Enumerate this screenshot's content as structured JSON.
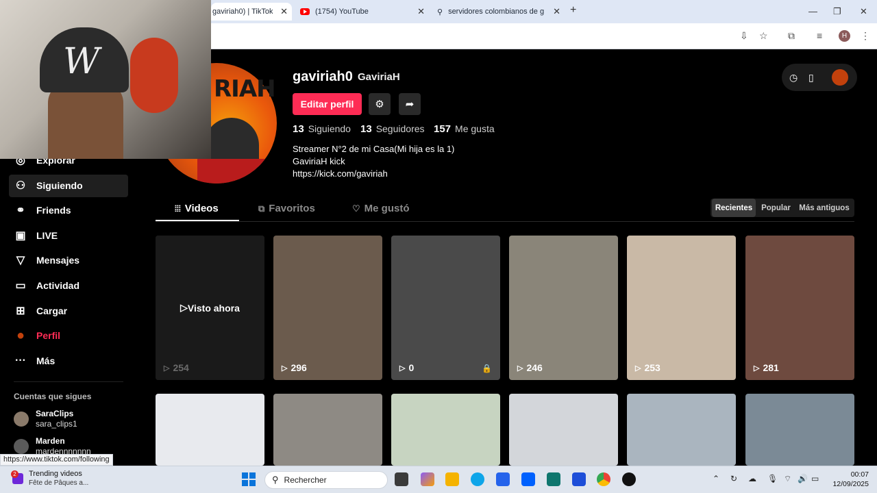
{
  "browser": {
    "tabs": [
      {
        "title": "gaviriah0) | TikTok",
        "active": true
      },
      {
        "title": "(1754) YouTube",
        "active": false
      },
      {
        "title": "servidores colombianos de gta",
        "active": false
      }
    ],
    "new_tab": "+",
    "window_controls": {
      "minimize": "—",
      "maximize": "❐",
      "close": "✕"
    },
    "profile_initial": "H"
  },
  "sidebar": {
    "items": [
      {
        "label": "Explorar",
        "icon": "compass-icon",
        "glyph": "◎"
      },
      {
        "label": "Siguiendo",
        "icon": "following-icon",
        "glyph": "⚇"
      },
      {
        "label": "Friends",
        "icon": "friends-icon",
        "glyph": "⚭"
      },
      {
        "label": "LIVE",
        "icon": "live-icon",
        "glyph": "▣"
      },
      {
        "label": "Mensajes",
        "icon": "messages-icon",
        "glyph": "▽"
      },
      {
        "label": "Actividad",
        "icon": "activity-icon",
        "glyph": "▭"
      },
      {
        "label": "Cargar",
        "icon": "upload-icon",
        "glyph": "⊞"
      },
      {
        "label": "Perfil",
        "icon": "profile-avatar-icon",
        "glyph": "●"
      },
      {
        "label": "Más",
        "icon": "more-icon",
        "glyph": "···"
      }
    ],
    "following_title": "Cuentas que sigues",
    "accounts": [
      {
        "name": "SaraClips",
        "handle": "sara_clips1"
      },
      {
        "name": "Marden",
        "handle": "mardennnnnnn"
      }
    ],
    "status_url": "https://www.tiktok.com/following"
  },
  "profile": {
    "username": "gaviriah0",
    "nickname": "GaviriaH",
    "avatar_text": "RIAH",
    "edit_button": "Editar perfil",
    "stats": [
      {
        "value": "13",
        "label": "Siguiendo"
      },
      {
        "value": "13",
        "label": "Seguidores"
      },
      {
        "value": "157",
        "label": "Me gusta"
      }
    ],
    "bio": [
      "Streamer N°2 de mi Casa(Mi hija es la 1)",
      "GaviriaH kick",
      "https://kick.com/gaviriah"
    ]
  },
  "tabs": [
    {
      "label": "Videos",
      "icon": "grid-icon",
      "glyph": "⦙⦙⦙"
    },
    {
      "label": "Favoritos",
      "icon": "bookmark-icon",
      "glyph": "⧉"
    },
    {
      "label": "Me gustó",
      "icon": "heart-icon",
      "glyph": "♡"
    }
  ],
  "sort": [
    "Recientes",
    "Popular",
    "Más antiguos"
  ],
  "videos": [
    {
      "views": "254",
      "overlay": "Visto ahora",
      "bg": "#3b3b3b"
    },
    {
      "views": "296",
      "bg": "#6b5b4d"
    },
    {
      "views": "0",
      "locked": true,
      "bg": "#4a4a4a"
    },
    {
      "views": "246",
      "bg": "#8a8579"
    },
    {
      "views": "253",
      "bg": "#c9b9a6"
    },
    {
      "views": "281",
      "bg": "#6e4a3f"
    },
    {
      "bg": "#e8eaee"
    },
    {
      "bg": "#8e8a84"
    },
    {
      "bg": "#c7d4c1"
    },
    {
      "bg": "#d3d6da"
    },
    {
      "bg": "#aab5bf"
    },
    {
      "bg": "#7b8a96"
    }
  ],
  "taskbar": {
    "news_title": "Trending videos",
    "news_sub": "Fête de Pâques a...",
    "news_badge": "2",
    "search_placeholder": "Rechercher",
    "time": "00:07",
    "date": "12/09/2025"
  }
}
